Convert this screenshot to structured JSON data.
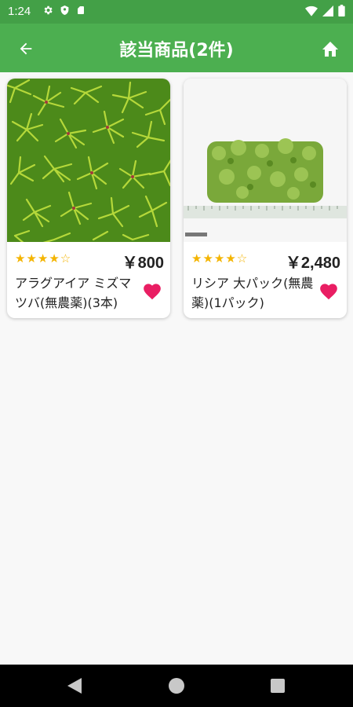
{
  "status_bar": {
    "time": "1:24",
    "left_icons": [
      "gear-icon",
      "shield-icon",
      "sd-card-icon"
    ],
    "right_icons": [
      "wifi-icon",
      "signal-icon",
      "battery-icon"
    ]
  },
  "app_bar": {
    "title": "該当商品(2件)",
    "background": "#4caf50"
  },
  "products": [
    {
      "stars": "★★★★☆",
      "price": "￥800",
      "name": "アラグアイア ミズマツバ(無農薬)(3本)",
      "favorited": true
    },
    {
      "stars": "★★★★☆",
      "price": "￥2,480",
      "name": "リシア 大パック(無農薬)(1パック)",
      "favorited": true
    }
  ],
  "colors": {
    "accent_green": "#4caf50",
    "star": "#f4b400",
    "heart": "#e91e63"
  }
}
